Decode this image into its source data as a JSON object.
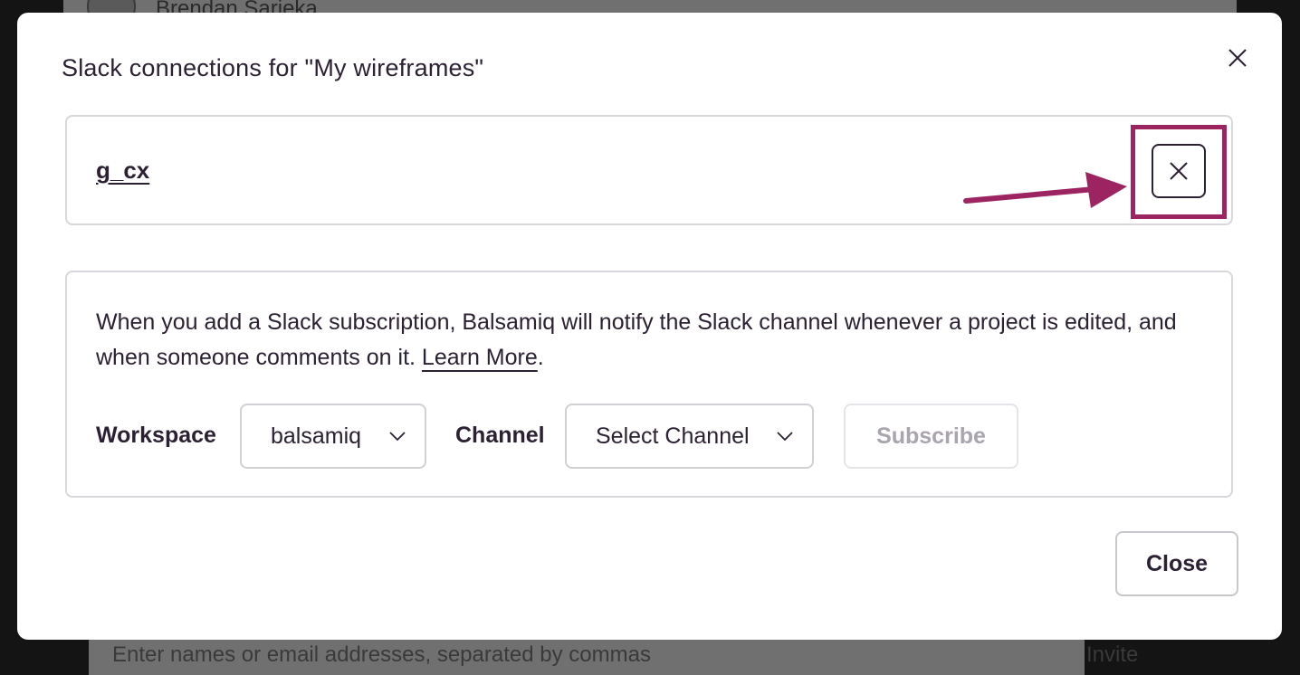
{
  "background": {
    "username": "Brendan Sarieka",
    "invite_placeholder": "Enter names or email addresses, separated by commas",
    "invite_button": "Invite"
  },
  "modal": {
    "title": "Slack connections for \"My wireframes\"",
    "close_icon": "close-icon",
    "connection": {
      "name": "g_cx",
      "remove_icon": "close-icon"
    },
    "annotation": {
      "color": "#9b2461",
      "arrow_icon": "arrow-right-icon"
    },
    "subscription": {
      "description": "When you add a Slack subscription, Balsamiq will notify the Slack channel whenever a project is edited, and when someone comments on it.",
      "learn_more": "Learn More",
      "period": ".",
      "workspace_label": "Workspace",
      "workspace_value": "balsamiq",
      "channel_label": "Channel",
      "channel_value": "Select Channel",
      "subscribe_label": "Subscribe"
    },
    "close_label": "Close"
  }
}
